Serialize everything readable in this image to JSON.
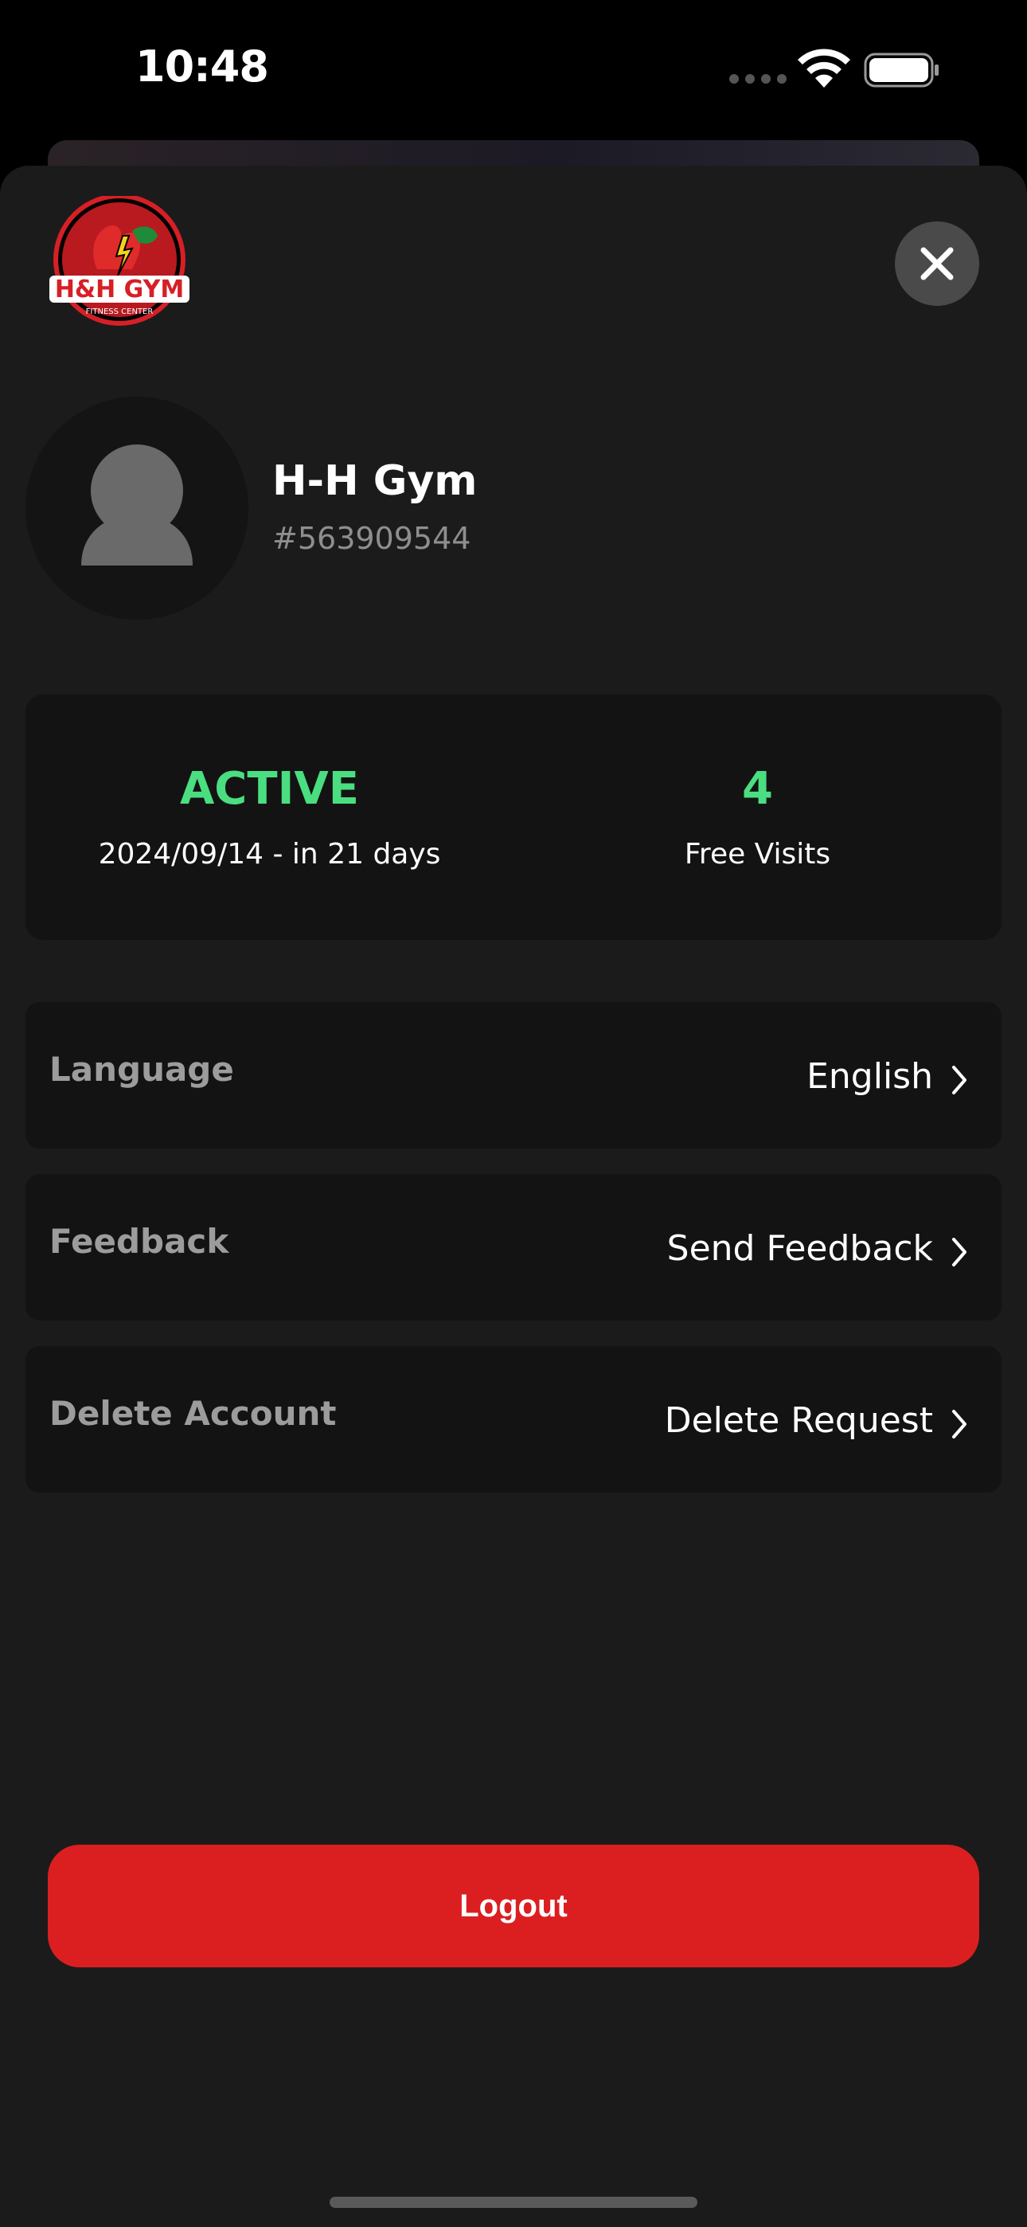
{
  "status_bar": {
    "time": "10:48"
  },
  "header": {
    "logo": {
      "main_text": "H&H GYM",
      "sub_text": "FITNESS CENTER"
    },
    "close_icon": "close-icon"
  },
  "profile": {
    "name": "H-H Gym",
    "id": "#563909544",
    "avatar_icon": "person-icon"
  },
  "membership": {
    "status": "ACTIVE",
    "expiry": "2024/09/14 - in 21 days",
    "free_visits_count": "4",
    "free_visits_label": "Free Visits",
    "accent_color": "#4ade80"
  },
  "settings": [
    {
      "label": "Language",
      "value": "English"
    },
    {
      "label": "Feedback",
      "value": "Send Feedback"
    },
    {
      "label": "Delete Account",
      "value": "Delete Request"
    }
  ],
  "logout": {
    "label": "Logout",
    "color": "#db1f21"
  }
}
